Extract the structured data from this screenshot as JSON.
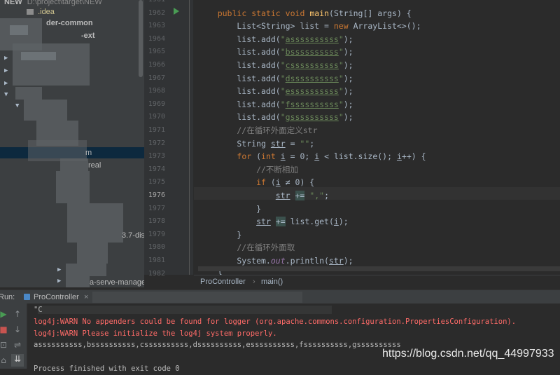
{
  "project_tree": {
    "root_label": "NEW",
    "root_path": "D:\\project\\target\\NEW",
    "idea_folder": ".idea",
    "items": [
      "der-common",
      "-ext",
      "m",
      "real",
      "3.7-dis",
      "a-serve-manage"
    ]
  },
  "editor": {
    "line_numbers": [
      "1961",
      "1962",
      "1963",
      "1964",
      "1965",
      "1966",
      "1967",
      "1968",
      "1969",
      "1970",
      "1971",
      "1972",
      "1973",
      "1974",
      "1975",
      "1976",
      "1977",
      "1978",
      "1979",
      "1980",
      "1981",
      "1982"
    ],
    "lines": [
      "",
      "    public static void main(String[] args) {",
      "        List<String> list = new ArrayList<>();",
      "        list.add(\"assssssssss\");",
      "        list.add(\"bssssssssss\");",
      "        list.add(\"cssssssssss\");",
      "        list.add(\"dssssssssss\");",
      "        list.add(\"essssssssss\");",
      "        list.add(\"fssssssssss\");",
      "        list.add(\"gssssssssss\");",
      "        //在循环外面定义str",
      "        String str = \"\";",
      "        for (int i = 0; i < list.size(); i++) {",
      "            //不断相加",
      "            if (i ≠ 0) {",
      "                str += \",\";",
      "            }",
      "            str += list.get(i);",
      "        }",
      "        //在循环外面取",
      "        System.out.println(str);",
      "    }"
    ],
    "current_line": "1976"
  },
  "breadcrumb": {
    "class_name": "ProController",
    "separator": "›",
    "method_name": "main()"
  },
  "run_panel": {
    "title": "Run:",
    "tab_label": "ProController",
    "close_label": "×",
    "console_lines": [
      {
        "text": "\"C",
        "type": "out"
      },
      {
        "text": "log4j:WARN No appenders could be found for logger (org.apache.commons.configuration.PropertiesConfiguration).",
        "type": "err"
      },
      {
        "text": "log4j:WARN Please initialize the log4j system properly.",
        "type": "err"
      },
      {
        "text": "assssssssss,bssssssssss,cssssssssss,dssssssssss,essssssssss,fssssssssss,gssssssssss",
        "type": "out"
      },
      {
        "text": "",
        "type": "out"
      },
      {
        "text": "Process finished with exit code 0",
        "type": "out"
      }
    ]
  },
  "watermark": "https://blog.csdn.net/qq_44997933",
  "colors": {
    "editor_bg": "#2B2B2B",
    "keyword": "#CC7832",
    "string": "#6A8759",
    "comment": "#808080",
    "method": "#FFC66D",
    "error": "#FF6B68"
  }
}
